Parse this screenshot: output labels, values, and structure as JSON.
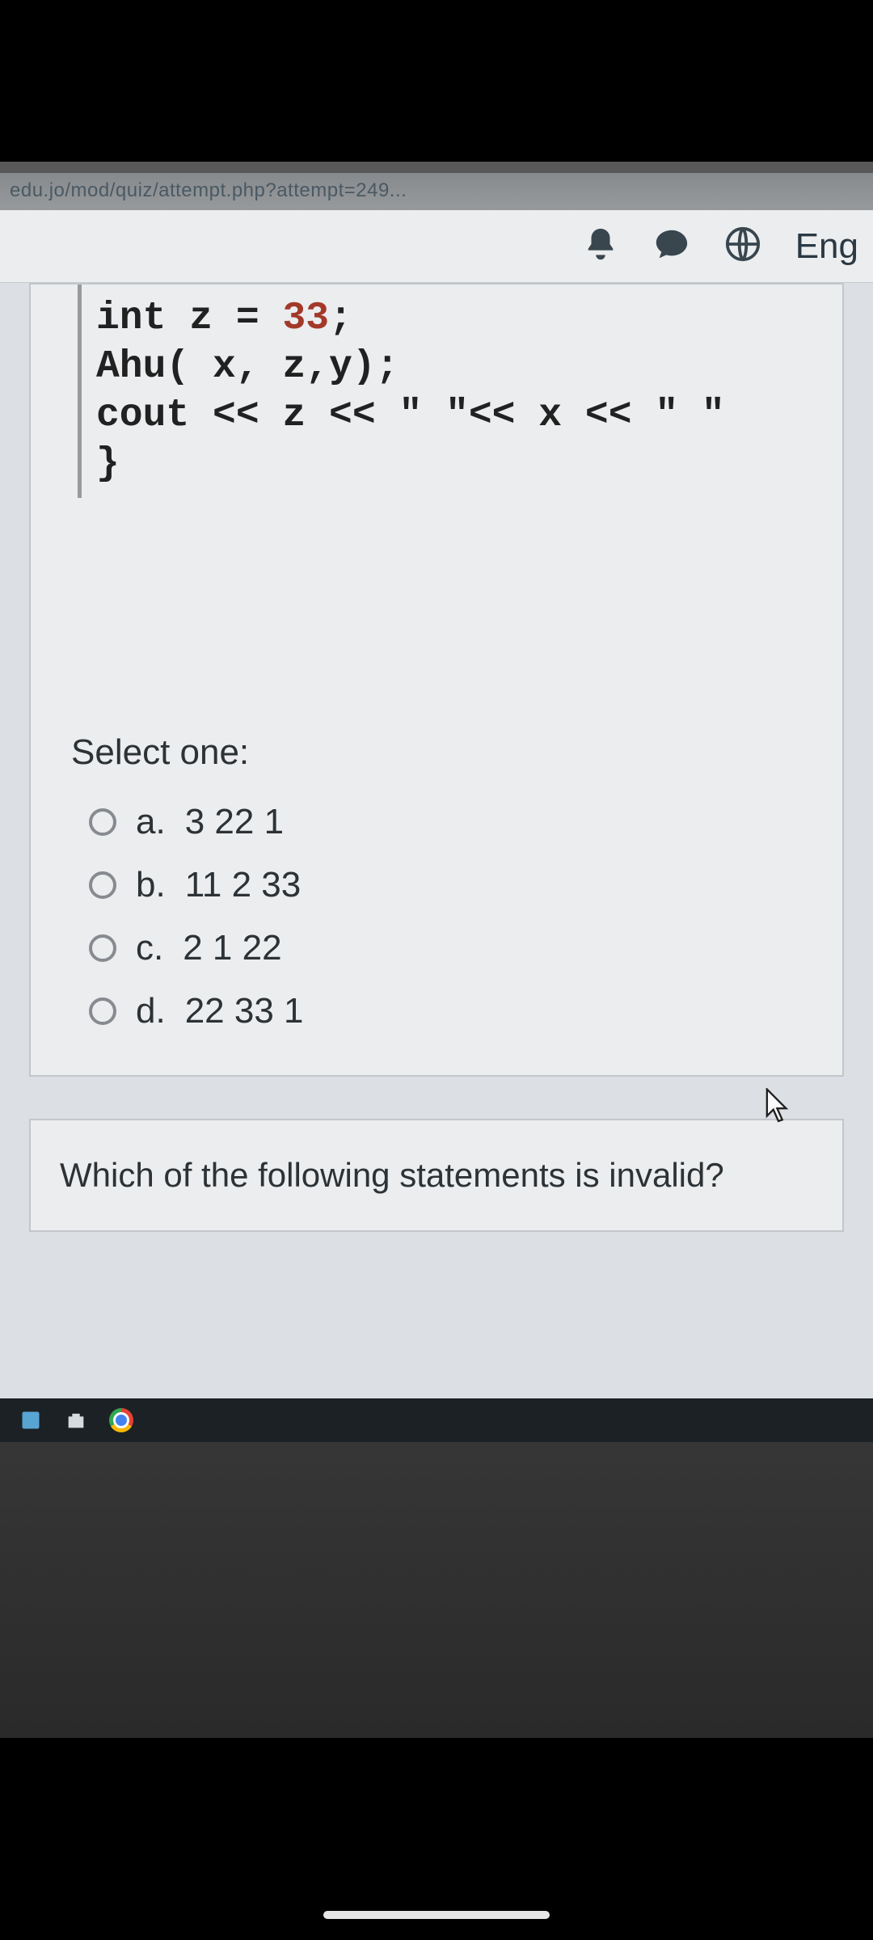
{
  "url_fragment": "edu.jo/mod/quiz/attempt.php?attempt=249...",
  "header": {
    "language": "Eng"
  },
  "code": {
    "line1_a": "int z = ",
    "line1_num": "33",
    "line1_b": ";",
    "line2": "Ahu( x, z,y);",
    "line3": "cout << z << \" \"<< x << \" \"",
    "line4": "}"
  },
  "select_label": "Select one:",
  "options": [
    {
      "letter": "a.",
      "text": "3 22 1"
    },
    {
      "letter": "b.",
      "text": "11 2 33"
    },
    {
      "letter": "c.",
      "text": "2 1 22"
    },
    {
      "letter": "d.",
      "text": "22 33 1"
    }
  ],
  "next_question": "Which of the following statements is invalid?"
}
